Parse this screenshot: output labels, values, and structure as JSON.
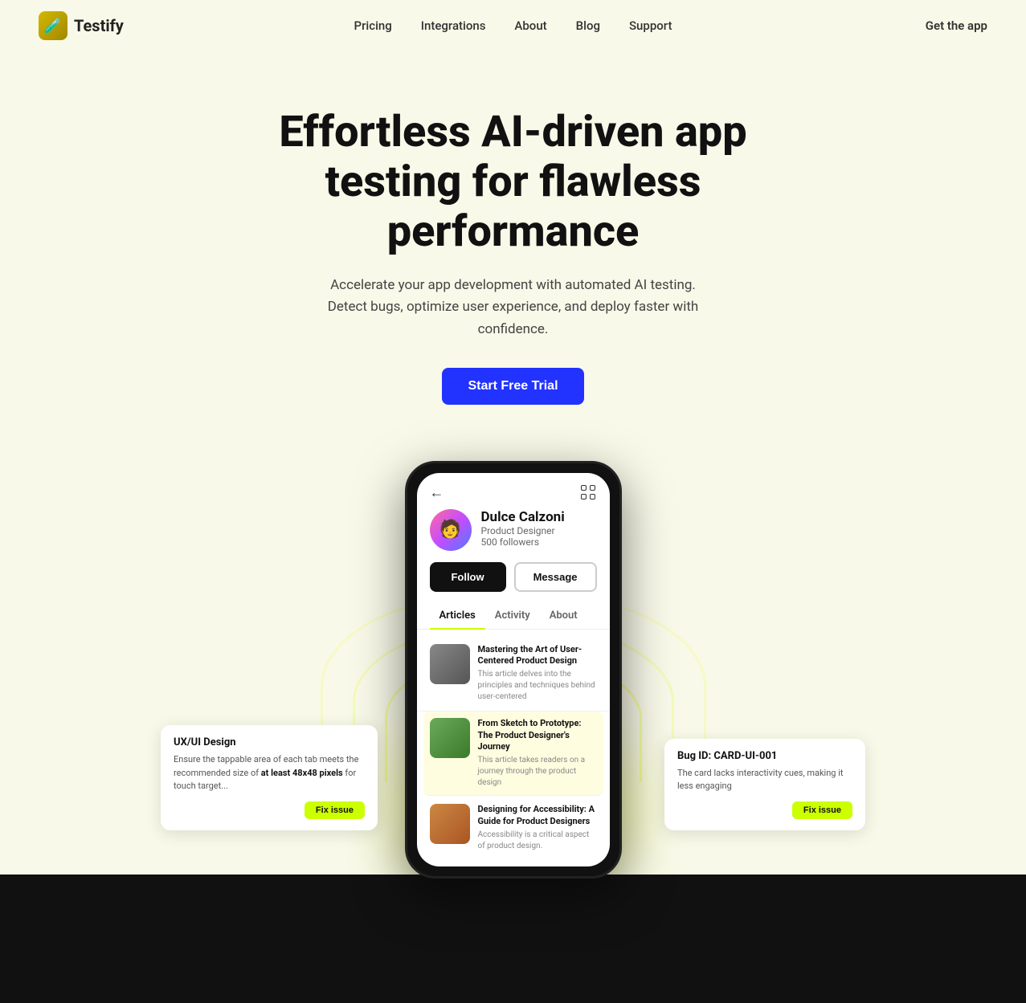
{
  "nav": {
    "logo_text": "Testify",
    "links": [
      {
        "label": "Pricing",
        "id": "pricing"
      },
      {
        "label": "Integrations",
        "id": "integrations"
      },
      {
        "label": "About",
        "id": "about"
      },
      {
        "label": "Blog",
        "id": "blog"
      },
      {
        "label": "Support",
        "id": "support"
      }
    ],
    "cta": "Get the app"
  },
  "hero": {
    "title": "Effortless AI-driven app testing for flawless performance",
    "subtitle": "Accelerate your app development with automated AI testing. Detect bugs, optimize user experience, and deploy faster with confidence.",
    "cta": "Start Free Trial"
  },
  "phone": {
    "profile": {
      "name": "Dulce Calzoni",
      "title": "Product Designer",
      "followers": "500 followers",
      "follow_btn": "Follow",
      "message_btn": "Message"
    },
    "tabs": [
      "Articles",
      "Activity",
      "About"
    ],
    "active_tab": "Articles",
    "articles": [
      {
        "title": "Mastering the Art of User-Centered Product Design",
        "desc": "This article delves into the principles and techniques behind user-centered",
        "highlighted": false
      },
      {
        "title": "From Sketch to Prototype: The Product Designer's Journey",
        "desc": "This article takes readers on a journey through the product design",
        "highlighted": true
      },
      {
        "title": "Designing for Accessibility: A Guide for Product Designers",
        "desc": "Accessibility is a critical aspect of product design.",
        "highlighted": false
      }
    ]
  },
  "tooltips": {
    "left": {
      "header": "UX/UI Design",
      "body": "Ensure the tappable area of each tab meets the recommended size of at least 48x48 pixels for touch target...",
      "fix_btn": "Fix issue"
    },
    "right": {
      "header": "Bug ID: CARD-UI-001",
      "body": "The card lacks interactivity cues, making it less engaging",
      "fix_btn": "Fix issue"
    }
  }
}
